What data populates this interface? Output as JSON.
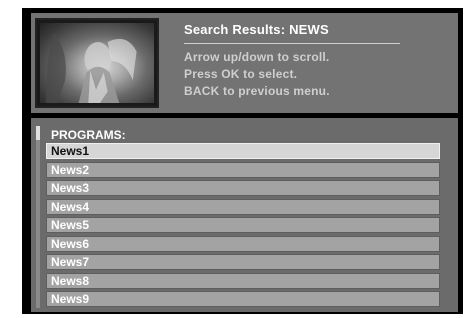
{
  "header": {
    "title": "Search Results: NEWS",
    "instructions": [
      "Arrow up/down to scroll.",
      "Press OK to select.",
      "BACK to previous menu."
    ]
  },
  "programs": {
    "label": "PROGRAMS:",
    "items": [
      "News1",
      "News2",
      "News3",
      "News4",
      "News5",
      "News6",
      "News7",
      "News8",
      "News9"
    ],
    "selected_index": 0
  },
  "colors": {
    "background": "#000000",
    "panel": "#737373",
    "item": "#a3a3a3",
    "item_selected": "#d6d6d6"
  }
}
